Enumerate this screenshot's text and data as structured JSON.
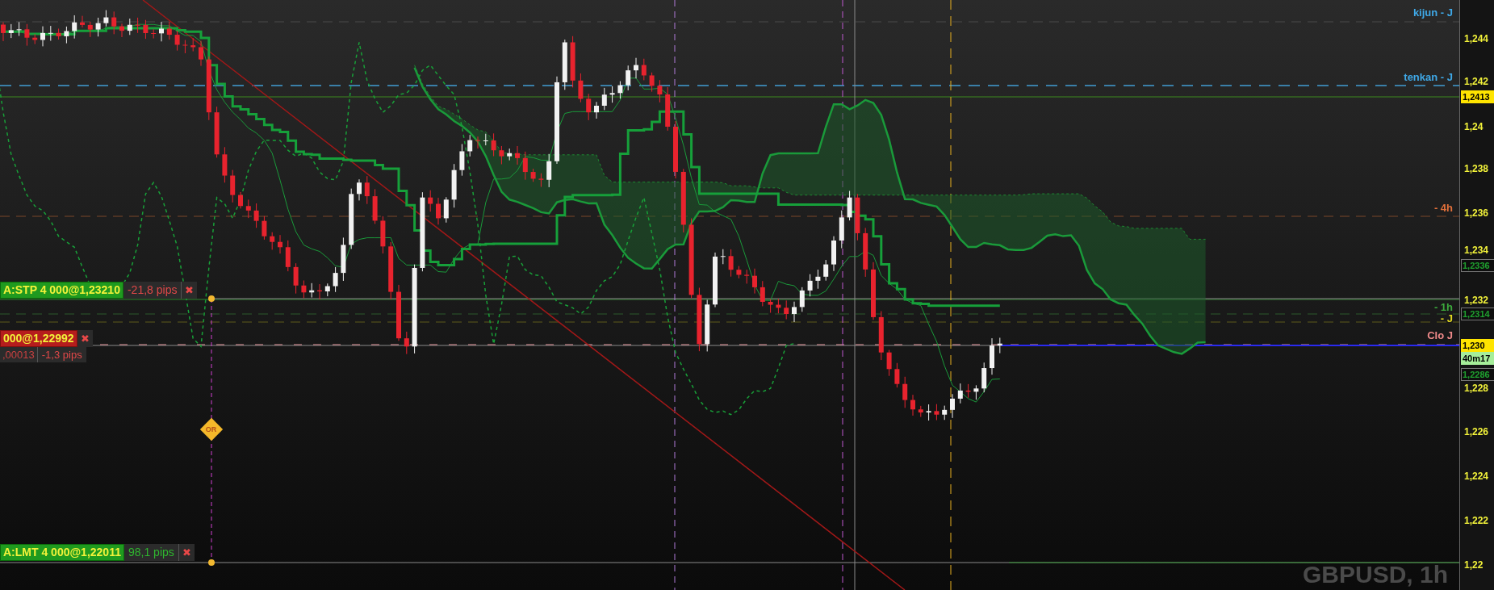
{
  "symbol_label": "GBPUSD, 1h",
  "line_labels": [
    {
      "text": "kijun - J",
      "color": "#3fa9e8"
    },
    {
      "text": "tenkan - J",
      "color": "#3fa9e8"
    },
    {
      "text": "- 4h",
      "color": "#e2703a"
    },
    {
      "text": "- 1h",
      "color": "#3caa3c"
    },
    {
      "text": "- J",
      "color": "#e0d820"
    },
    {
      "text": "Clo J",
      "color": "#f08a8a"
    }
  ],
  "orders": [
    {
      "kind": "stop",
      "label": "A:STP 4 000@1,23210",
      "pips": "-21,8 pips",
      "gain": false,
      "close": "✖"
    },
    {
      "kind": "position",
      "label": "000@1,22992",
      "close": "✖",
      "detail": ",00013",
      "pips": "-1,3 pips",
      "gain": false
    },
    {
      "kind": "limit",
      "label": "A:LMT 4 000@1,22011",
      "pips": "98,1 pips",
      "gain": true,
      "close": "✖"
    }
  ],
  "event_marker": "OR",
  "price_axis": {
    "ticks": [
      "1,244",
      "1,242",
      "1,24",
      "1,238",
      "1,236",
      "1,234",
      "1,232",
      "1,228",
      "1,226",
      "1,224",
      "1,222",
      "1,22"
    ],
    "markers": [
      {
        "kind": "price",
        "text": "1,2413"
      },
      {
        "kind": "level",
        "text": "1,2336"
      },
      {
        "kind": "level",
        "text": "1,2314"
      },
      {
        "kind": "price",
        "text": "1,230"
      },
      {
        "kind": "timer",
        "text": "40m17"
      },
      {
        "kind": "level",
        "text": "1,2286"
      }
    ]
  }
}
